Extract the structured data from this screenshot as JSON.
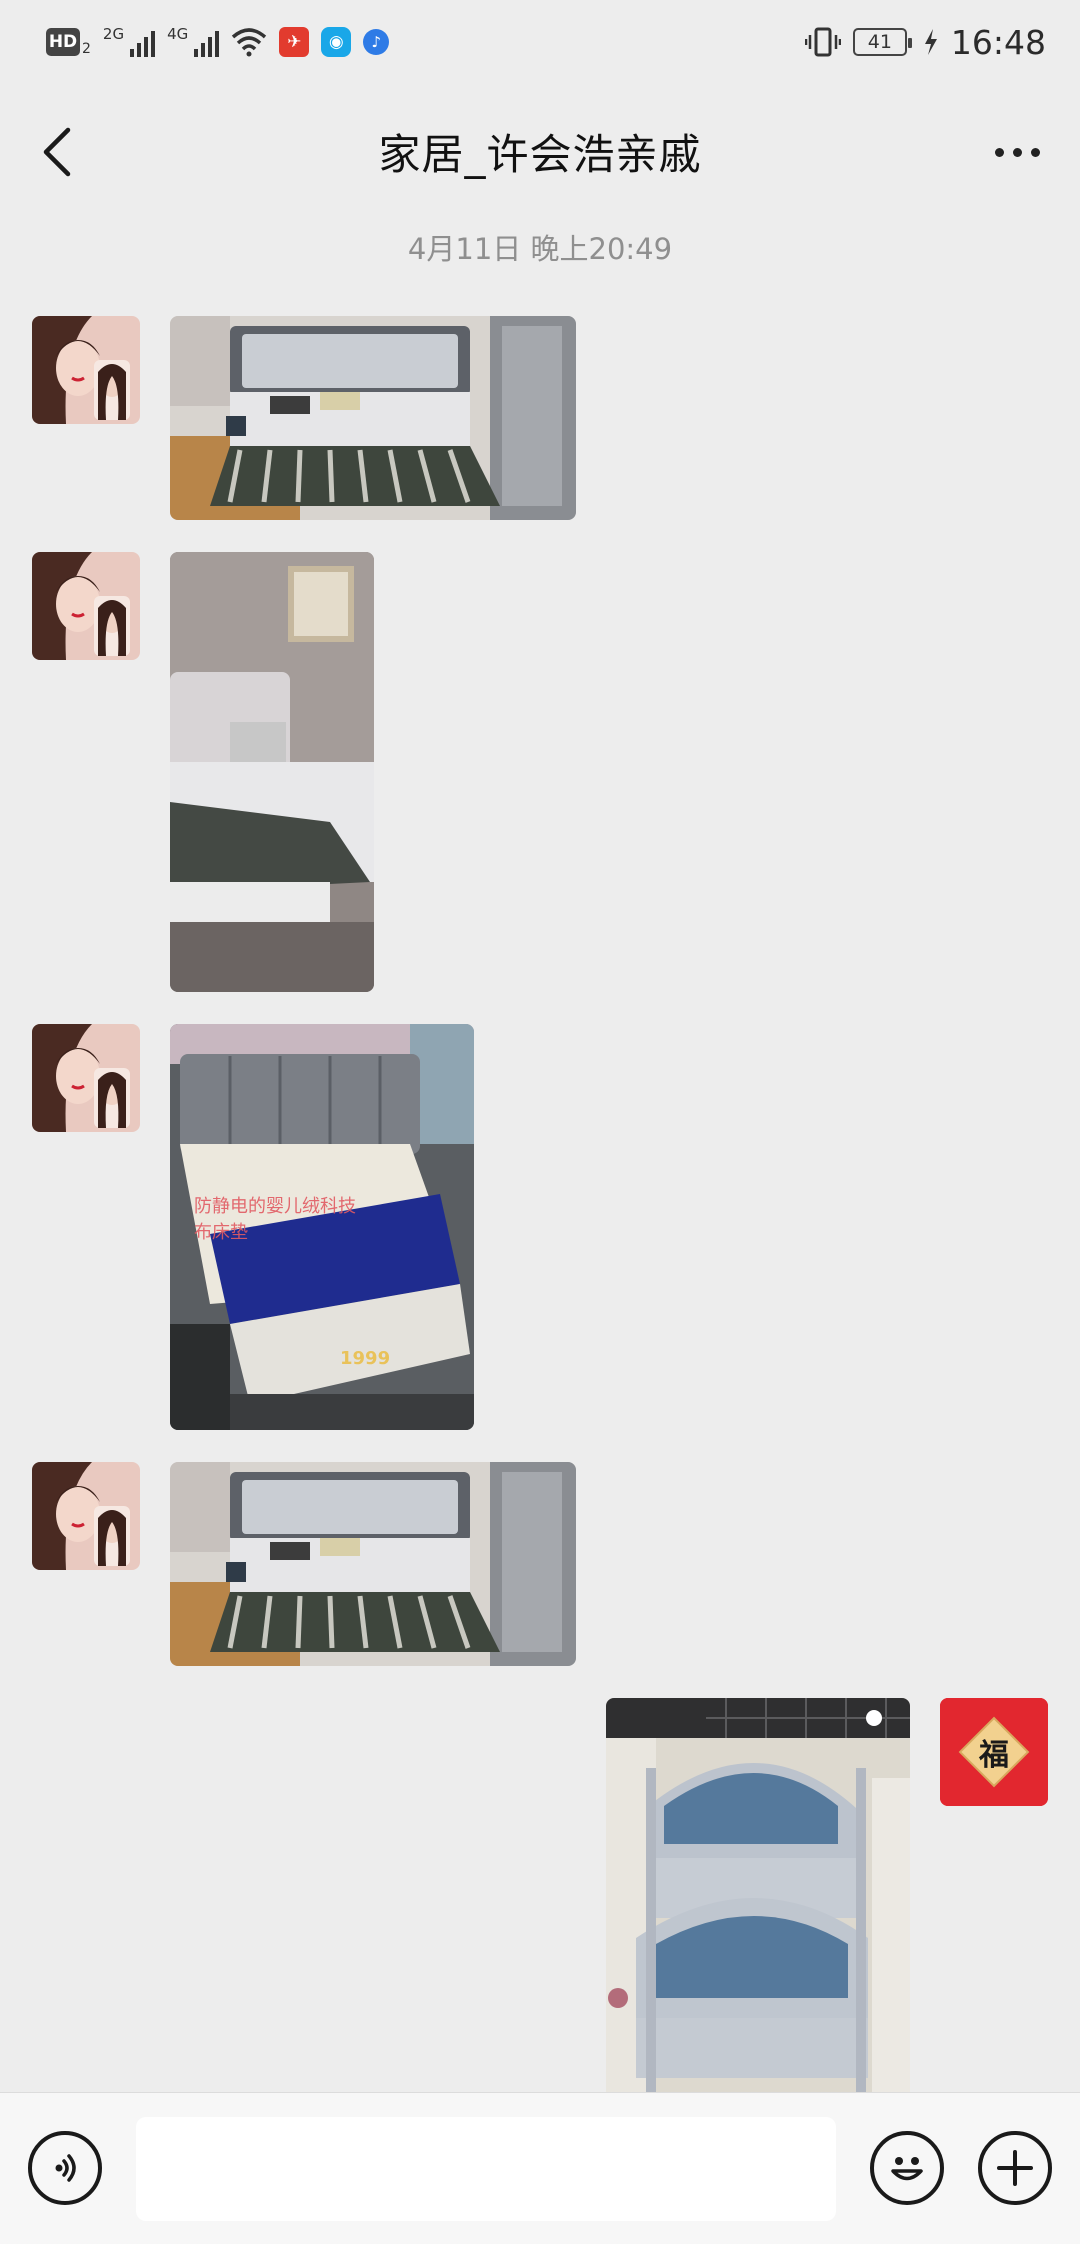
{
  "status_bar": {
    "hd_label": "HD",
    "hd_sub": "2",
    "sig1_label": "2G",
    "sig2_label": "4G",
    "battery": "41",
    "time": "16:48"
  },
  "header": {
    "title": "家居_许会浩亲戚"
  },
  "chat": {
    "timestamp": "4月11日 晚上20:49",
    "image_overlay_text_1": "防静电的婴儿绒科技",
    "image_overlay_text_2": "布床垫",
    "image_overlay_badge": "1999",
    "sticker_text": "福"
  },
  "input": {
    "placeholder": ""
  },
  "colors": {
    "chat_bg": "#EDEDED",
    "input_bar_bg": "#F7F7F7",
    "sticker_red": "#E2272F",
    "sticker_gold": "#F2D18F"
  }
}
